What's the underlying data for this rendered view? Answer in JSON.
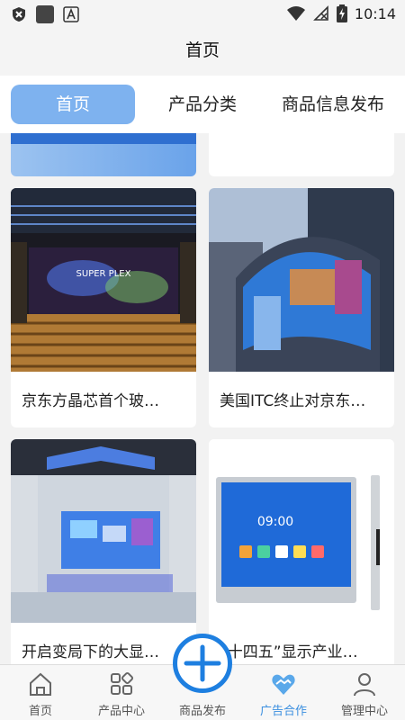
{
  "status_bar": {
    "time": "10:14"
  },
  "header": {
    "title": "首页"
  },
  "tabs": [
    {
      "label": "首页",
      "active": true
    },
    {
      "label": "产品分类",
      "active": false
    },
    {
      "label": "商品信息发布",
      "active": false
    }
  ],
  "cards": [
    {
      "title": "京东方晶芯首个玻…"
    },
    {
      "title": "美国ITC终止对京东…"
    },
    {
      "title": "开启变局下的大显…"
    },
    {
      "title": "“十四五”显示产业…"
    }
  ],
  "bottom_nav": [
    {
      "label": "首页",
      "icon": "home-icon"
    },
    {
      "label": "产品中心",
      "icon": "grid-icon"
    },
    {
      "label": "商品发布",
      "icon": "plus-icon"
    },
    {
      "label": "广告合作",
      "icon": "heart-handshake-icon",
      "active": true
    },
    {
      "label": "管理中心",
      "icon": "user-icon"
    }
  ],
  "colors": {
    "accent": "#7eb2ef",
    "nav_active": "#3b8fe0",
    "fab": "#1e7fe0"
  }
}
